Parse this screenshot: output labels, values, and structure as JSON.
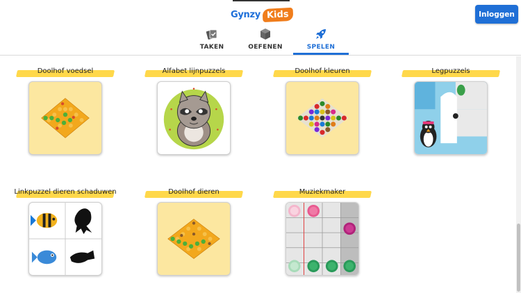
{
  "header": {
    "logo_text": "Gynzy",
    "logo_kids": "Kids",
    "login_label": "Inloggen",
    "tabs": [
      {
        "label": "TAKEN",
        "icon": "cards-icon",
        "active": false
      },
      {
        "label": "OEFENEN",
        "icon": "cube-icon",
        "active": false
      },
      {
        "label": "SPELEN",
        "icon": "rocket-icon",
        "active": true
      }
    ]
  },
  "games": [
    {
      "title": "Doolhof voedsel",
      "icon": "hexagon-maze-food-icon"
    },
    {
      "title": "Alfabet lijnpuzzels",
      "icon": "raccoon-dot-puzzle-icon"
    },
    {
      "title": "Doolhof kleuren",
      "icon": "hexagon-maze-colors-icon"
    },
    {
      "title": "Legpuzzels",
      "icon": "jigsaw-penguin-icon"
    },
    {
      "title": "Linkpuzzel dieren schaduwen",
      "icon": "animal-shadow-icon"
    },
    {
      "title": "Doolhof dieren",
      "icon": "hexagon-maze-animals-icon"
    },
    {
      "title": "Muziekmaker",
      "icon": "music-grid-icon"
    }
  ],
  "colors": {
    "accent": "#1f6fd6",
    "highlight": "#ffd84a",
    "logo_orange": "#f07d1c"
  }
}
